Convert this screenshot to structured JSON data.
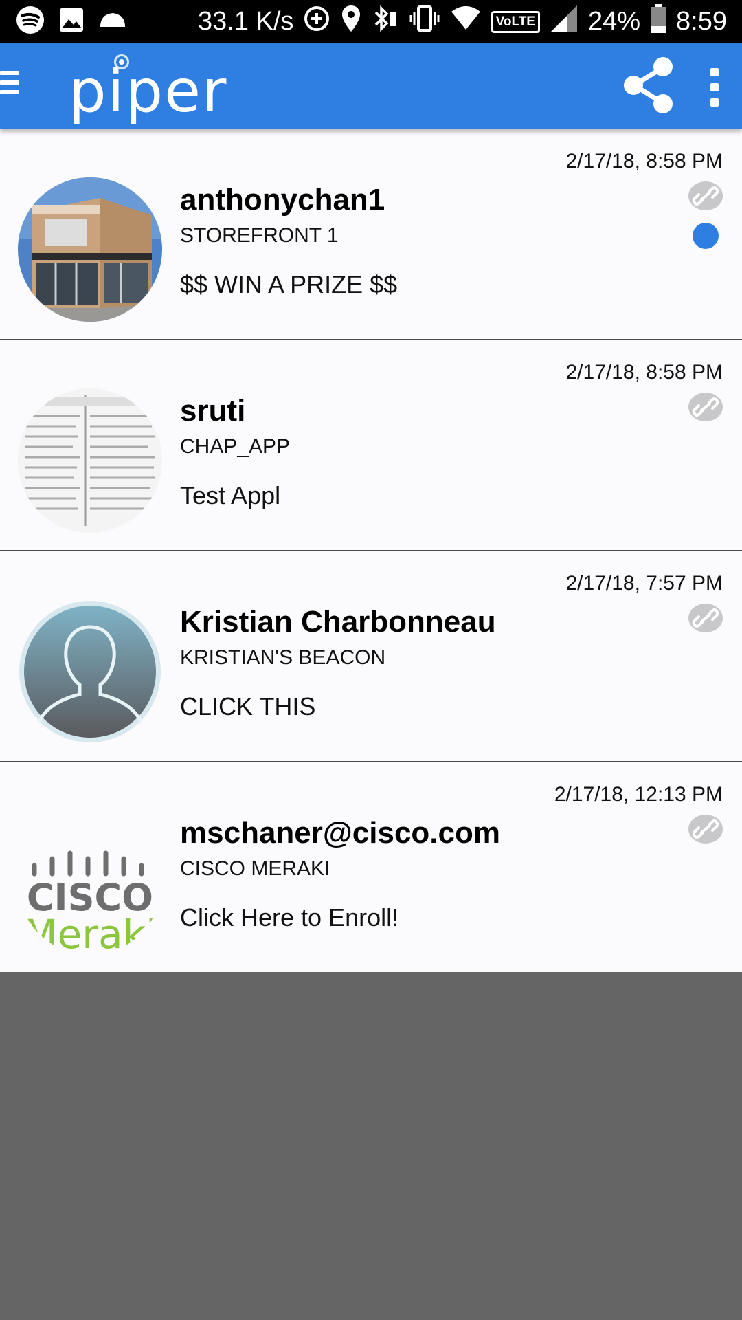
{
  "status_bar": {
    "speed": "33.1 K/s",
    "volte": "VoLTE",
    "battery": "24%",
    "time": "8:59"
  },
  "app_bar": {
    "logo": "piper"
  },
  "colors": {
    "accent": "#2f7fe3",
    "background": "#666566",
    "list_bg": "#fbfafc"
  },
  "messages": [
    {
      "timestamp": "2/17/18, 8:58 PM",
      "sender": "anthonychan1",
      "beacon": "STOREFRONT 1",
      "text": "$$ WIN A PRIZE $$",
      "unread": true,
      "icon": "link-icon"
    },
    {
      "timestamp": "2/17/18, 8:58 PM",
      "sender": "sruti",
      "beacon": "CHAP_APP",
      "text": "Test Appl",
      "unread": false,
      "icon": "link-icon"
    },
    {
      "timestamp": "2/17/18, 7:57 PM",
      "sender": "Kristian Charbonneau",
      "beacon": "KRISTIAN'S BEACON",
      "text": "CLICK THIS",
      "unread": false,
      "icon": "link-icon"
    },
    {
      "timestamp": "2/17/18, 12:13 PM",
      "sender": "mschaner@cisco.com",
      "beacon": "CISCO MERAKI",
      "text": "Click Here to Enroll!",
      "unread": false,
      "icon": "link-icon",
      "avatar_text": {
        "brand": "CISCO",
        "product": "Meraki"
      }
    }
  ]
}
